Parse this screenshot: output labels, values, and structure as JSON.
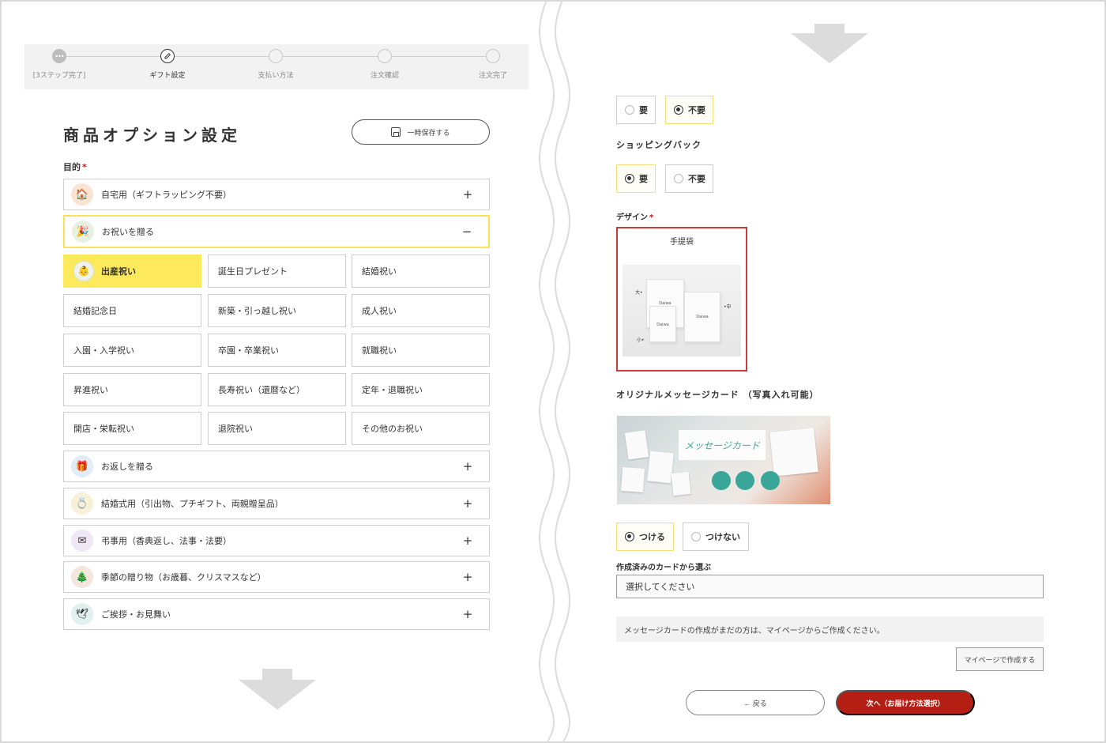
{
  "stepper": {
    "steps": [
      {
        "label": "[3ステップ完了]",
        "state": "done",
        "icon": "ellipsis-icon"
      },
      {
        "label": "ギフト設定",
        "state": "current",
        "icon": "pencil-icon"
      },
      {
        "label": "支払い方法",
        "state": "todo"
      },
      {
        "label": "注文確認",
        "state": "todo"
      },
      {
        "label": "注文完了",
        "state": "todo"
      }
    ]
  },
  "page": {
    "title": "商品オプション設定",
    "save_label": "一時保存する",
    "purpose_label": "目的",
    "required_mark": "*"
  },
  "purposes": [
    {
      "label": "自宅用（ギフトラッピング不要）",
      "icon": "house-icon",
      "toggle": "+"
    },
    {
      "label": "お祝いを贈る",
      "icon": "party-popper-icon",
      "toggle": "−"
    },
    {
      "label": "お返しを贈る",
      "icon": "gift-hand-icon",
      "toggle": "+"
    },
    {
      "label": "結婚式用（引出物、プチギフト、両親贈呈品）",
      "icon": "rings-icon",
      "toggle": "+"
    },
    {
      "label": "弔事用（香典返し、法事・法要）",
      "icon": "envelope-icon",
      "toggle": "+"
    },
    {
      "label": "季節の贈り物（お歳暮、クリスマスなど）",
      "icon": "tree-icon",
      "toggle": "+"
    },
    {
      "label": "ご挨拶・お見舞い",
      "icon": "dove-icon",
      "toggle": "+"
    }
  ],
  "celebration_options": [
    {
      "label": "出産祝い",
      "selected": true
    },
    {
      "label": "誕生日プレゼント",
      "selected": false
    },
    {
      "label": "結婚祝い",
      "selected": false
    },
    {
      "label": "結婚記念日",
      "selected": false
    },
    {
      "label": "新築・引っ越し祝い",
      "selected": false
    },
    {
      "label": "成人祝い",
      "selected": false
    },
    {
      "label": "入園・入学祝い",
      "selected": false
    },
    {
      "label": "卒園・卒業祝い",
      "selected": false
    },
    {
      "label": "就職祝い",
      "selected": false
    },
    {
      "label": "昇進祝い",
      "selected": false
    },
    {
      "label": "長寿祝い（還暦など）",
      "selected": false
    },
    {
      "label": "定年・退職祝い",
      "selected": false
    },
    {
      "label": "開店・栄転祝い",
      "selected": false
    },
    {
      "label": "退院祝い",
      "selected": false
    },
    {
      "label": "その他のお祝い",
      "selected": false
    }
  ],
  "right": {
    "first_radio": {
      "yes": "要",
      "no": "不要",
      "selected": "no"
    },
    "shopping_bag": {
      "label": "ショッピングバック",
      "yes": "要",
      "no": "不要",
      "selected": "yes"
    },
    "design": {
      "label": "デザイン",
      "card_title": "手提袋",
      "brand": "Daiwa",
      "size_large": "大•",
      "size_medium": "•中",
      "size_small": "小•"
    },
    "message_card": {
      "label": "オリジナルメッセージカード （写真入れ可能）",
      "banner_text": "メッセージカード",
      "attach": "つける",
      "no_attach": "つけない",
      "selected": "attach"
    },
    "choose_label": "作成済みのカードから選ぶ",
    "select_placeholder": "選択してください",
    "note": "メッセージカードの作成がまだの方は、マイページからご作成ください。",
    "mypage_button": "マイページで作成する",
    "back_button": "← 戻る",
    "next_button": "次へ（お届け方法選択）"
  },
  "colors": {
    "accent_yellow": "#fde95c",
    "primary_red": "#b51e12",
    "design_border": "#c63b3b"
  }
}
